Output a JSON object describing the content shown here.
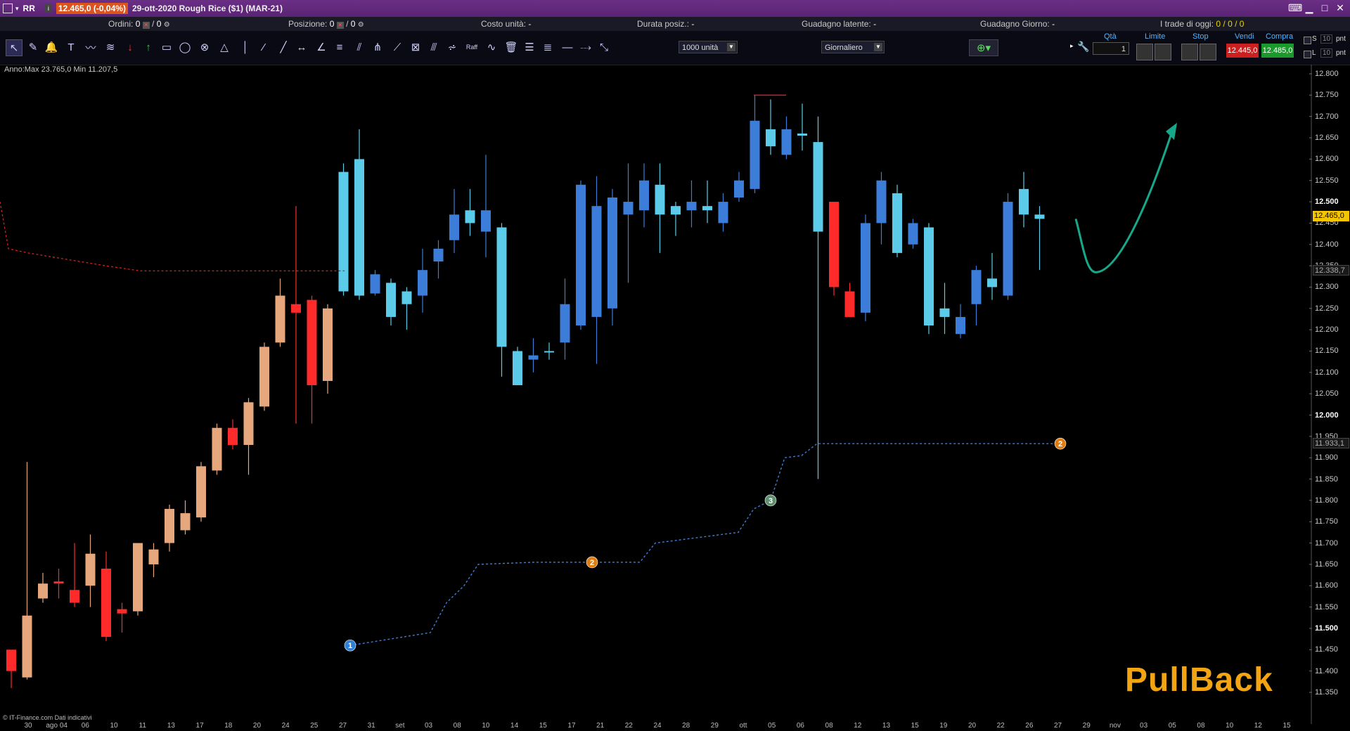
{
  "title_bar": {
    "symbol": "RR",
    "price_change": "12.465,0 (-0,04%)",
    "instrument": "29-ott-2020 Rough Rice ($1) (MAR-21)"
  },
  "info_bar": {
    "ordini_label": "Ordini:",
    "ordini_value": "0",
    "ordini_value2": "0",
    "posizione_label": "Posizione:",
    "posizione_value": "0",
    "posizione_value2": "0",
    "costo_label": "Costo unità:",
    "costo_value": "-",
    "durata_label": "Durata posiz.:",
    "durata_value": "-",
    "guadagno_latente_label": "Guadagno latente:",
    "guadagno_latente_value": "-",
    "guadagno_giorno_label": "Guadagno Giorno:",
    "guadagno_giorno_value": "-",
    "trade_oggi_label": "I trade di oggi:",
    "trade_oggi_value": "0 / 0 / 0"
  },
  "toolbar": {
    "quantity_select": "1000 unità",
    "period_select": "Giornaliero",
    "raff_label": "Raff"
  },
  "order_panel": {
    "qty_label": "Qtà",
    "qty_value": "1",
    "limit_label": "Limite",
    "stop_label": "Stop",
    "sell_label": "Vendi",
    "buy_label": "Compra",
    "sell_price": "12.445,0",
    "buy_price": "12.485,0",
    "s_label": "S",
    "l_label": "L",
    "s_value": "10",
    "l_value": "10",
    "pnt_label": "pnt"
  },
  "annotation": "Anno:Max 23.765,0 Min 11.207,5",
  "footer": "© IT-Finance.com Dati indicativi",
  "watermark": "PullBack",
  "colors": {
    "bull_orange": "#e7a77c",
    "bear_red": "#ff2a2a",
    "bull_cyan": "#5ccbe9",
    "bear_blue": "#3b7dd8",
    "accent_teal": "#17a88a",
    "dotted_red": "#d52020",
    "dotted_blue": "#3b7dd8"
  },
  "price_axis": {
    "ticks": [
      "12.800",
      "12.750",
      "12.700",
      "12.650",
      "12.600",
      "12.550",
      "12.500",
      "12.450",
      "12.400",
      "12.350",
      "12.300",
      "12.250",
      "12.200",
      "12.150",
      "12.100",
      "12.050",
      "12.000",
      "11.950",
      "11.900",
      "11.850",
      "11.800",
      "11.750",
      "11.700",
      "11.650",
      "11.600",
      "11.550",
      "11.500",
      "11.450",
      "11.400",
      "11.350"
    ],
    "bold_ticks": [
      "12.500",
      "12.000",
      "11.500"
    ],
    "current_price": "12.465,0",
    "red_line_price": "12.338,7",
    "blue_line_price": "11.933,1"
  },
  "date_axis": {
    "labels": [
      "30",
      "ago 04",
      "06",
      "10",
      "11",
      "13",
      "17",
      "18",
      "20",
      "24",
      "25",
      "27",
      "31",
      "set",
      "03",
      "08",
      "10",
      "14",
      "15",
      "17",
      "21",
      "22",
      "24",
      "28",
      "29",
      "ott",
      "05",
      "06",
      "08",
      "12",
      "13",
      "15",
      "19",
      "20",
      "22",
      "26",
      "27",
      "29",
      "nov",
      "03",
      "05",
      "08",
      "10",
      "12",
      "15"
    ]
  },
  "markers": [
    {
      "label": "1",
      "color": "#2e7fd6"
    },
    {
      "label": "2",
      "color": "#e07d12"
    },
    {
      "label": "3",
      "color": "#5f8f6f"
    },
    {
      "label": "2",
      "color": "#e07d12"
    }
  ],
  "chart_data": {
    "type": "candlestick",
    "ylim": [
      11.32,
      12.83
    ],
    "series": [
      {
        "name": "orange_bull",
        "color": "#e7a77c"
      },
      {
        "name": "red_bear",
        "color": "#ff2a2a"
      },
      {
        "name": "cyan_bull",
        "color": "#5ccbe9"
      },
      {
        "name": "blue_bear",
        "color": "#3b7dd8"
      }
    ],
    "candles": [
      {
        "o": 11.4,
        "h": 11.43,
        "l": 11.36,
        "c": 11.45,
        "k": "r"
      },
      {
        "o": 11.385,
        "h": 11.89,
        "l": 11.38,
        "c": 11.53,
        "k": "o"
      },
      {
        "o": 11.57,
        "h": 11.63,
        "l": 11.56,
        "c": 11.605,
        "k": "o"
      },
      {
        "o": 11.605,
        "h": 11.64,
        "l": 11.57,
        "c": 11.61,
        "k": "r"
      },
      {
        "o": 11.59,
        "h": 11.7,
        "l": 11.55,
        "c": 11.56,
        "k": "r"
      },
      {
        "o": 11.6,
        "h": 11.72,
        "l": 11.55,
        "c": 11.675,
        "k": "o"
      },
      {
        "o": 11.64,
        "h": 11.68,
        "l": 11.47,
        "c": 11.48,
        "k": "r"
      },
      {
        "o": 11.545,
        "h": 11.56,
        "l": 11.49,
        "c": 11.535,
        "k": "r"
      },
      {
        "o": 11.54,
        "h": 11.66,
        "l": 11.53,
        "c": 11.7,
        "k": "o"
      },
      {
        "o": 11.65,
        "h": 11.7,
        "l": 11.62,
        "c": 11.685,
        "k": "o"
      },
      {
        "o": 11.7,
        "h": 11.79,
        "l": 11.68,
        "c": 11.78,
        "k": "o"
      },
      {
        "o": 11.73,
        "h": 11.8,
        "l": 11.72,
        "c": 11.77,
        "k": "o"
      },
      {
        "o": 11.76,
        "h": 11.89,
        "l": 11.75,
        "c": 11.88,
        "k": "o"
      },
      {
        "o": 11.87,
        "h": 11.98,
        "l": 11.86,
        "c": 11.97,
        "k": "o"
      },
      {
        "o": 11.97,
        "h": 11.99,
        "l": 11.92,
        "c": 11.93,
        "k": "r"
      },
      {
        "o": 11.93,
        "h": 12.04,
        "l": 11.86,
        "c": 12.03,
        "k": "o"
      },
      {
        "o": 12.02,
        "h": 12.17,
        "l": 12.01,
        "c": 12.16,
        "k": "o"
      },
      {
        "o": 12.17,
        "h": 12.32,
        "l": 12.16,
        "c": 12.28,
        "k": "o"
      },
      {
        "o": 12.26,
        "h": 12.49,
        "l": 11.98,
        "c": 12.24,
        "k": "r"
      },
      {
        "o": 12.27,
        "h": 12.28,
        "l": 11.98,
        "c": 12.07,
        "k": "r"
      },
      {
        "o": 12.08,
        "h": 12.26,
        "l": 12.05,
        "c": 12.25,
        "k": "o"
      },
      {
        "o": 12.29,
        "h": 12.59,
        "l": 12.28,
        "c": 12.57,
        "k": "c"
      },
      {
        "o": 12.28,
        "h": 12.67,
        "l": 12.27,
        "c": 12.6,
        "k": "c"
      },
      {
        "o": 12.33,
        "h": 12.34,
        "l": 12.28,
        "c": 12.285,
        "k": "b"
      },
      {
        "o": 12.31,
        "h": 12.32,
        "l": 12.21,
        "c": 12.23,
        "k": "c"
      },
      {
        "o": 12.29,
        "h": 12.3,
        "l": 12.2,
        "c": 12.26,
        "k": "c"
      },
      {
        "o": 12.28,
        "h": 12.39,
        "l": 12.24,
        "c": 12.34,
        "k": "b"
      },
      {
        "o": 12.36,
        "h": 12.41,
        "l": 12.32,
        "c": 12.39,
        "k": "b"
      },
      {
        "o": 12.41,
        "h": 12.53,
        "l": 12.38,
        "c": 12.47,
        "k": "b"
      },
      {
        "o": 12.45,
        "h": 12.53,
        "l": 12.42,
        "c": 12.48,
        "k": "c"
      },
      {
        "o": 12.48,
        "h": 12.61,
        "l": 12.37,
        "c": 12.43,
        "k": "b"
      },
      {
        "o": 12.44,
        "h": 12.45,
        "l": 12.09,
        "c": 12.16,
        "k": "c"
      },
      {
        "o": 12.15,
        "h": 12.16,
        "l": 12.07,
        "c": 12.07,
        "k": "c"
      },
      {
        "o": 12.13,
        "h": 12.18,
        "l": 12.1,
        "c": 12.14,
        "k": "b"
      },
      {
        "o": 12.15,
        "h": 12.17,
        "l": 12.13,
        "c": 12.15,
        "k": "c"
      },
      {
        "o": 12.17,
        "h": 12.32,
        "l": 12.13,
        "c": 12.26,
        "k": "b"
      },
      {
        "o": 12.21,
        "h": 12.55,
        "l": 12.2,
        "c": 12.54,
        "k": "b"
      },
      {
        "o": 12.49,
        "h": 12.56,
        "l": 12.12,
        "c": 12.23,
        "k": "b"
      },
      {
        "o": 12.25,
        "h": 12.53,
        "l": 12.21,
        "c": 12.51,
        "k": "b"
      },
      {
        "o": 12.47,
        "h": 12.59,
        "l": 12.31,
        "c": 12.5,
        "k": "b"
      },
      {
        "o": 12.48,
        "h": 12.59,
        "l": 12.44,
        "c": 12.55,
        "k": "b"
      },
      {
        "o": 12.47,
        "h": 12.59,
        "l": 12.38,
        "c": 12.54,
        "k": "c"
      },
      {
        "o": 12.49,
        "h": 12.5,
        "l": 12.42,
        "c": 12.47,
        "k": "c"
      },
      {
        "o": 12.48,
        "h": 12.55,
        "l": 12.44,
        "c": 12.5,
        "k": "b"
      },
      {
        "o": 12.49,
        "h": 12.55,
        "l": 12.45,
        "c": 12.48,
        "k": "c"
      },
      {
        "o": 12.45,
        "h": 12.52,
        "l": 12.43,
        "c": 12.5,
        "k": "b"
      },
      {
        "o": 12.51,
        "h": 12.57,
        "l": 12.5,
        "c": 12.55,
        "k": "b"
      },
      {
        "o": 12.53,
        "h": 12.75,
        "l": 12.52,
        "c": 12.69,
        "k": "b"
      },
      {
        "o": 12.67,
        "h": 12.74,
        "l": 12.61,
        "c": 12.63,
        "k": "c"
      },
      {
        "o": 12.67,
        "h": 12.7,
        "l": 12.6,
        "c": 12.61,
        "k": "b"
      },
      {
        "o": 12.66,
        "h": 12.73,
        "l": 12.62,
        "c": 12.655,
        "k": "c"
      },
      {
        "o": 12.64,
        "h": 12.7,
        "l": 11.85,
        "c": 12.43,
        "k": "c"
      },
      {
        "o": 12.5,
        "h": 12.49,
        "l": 12.28,
        "c": 12.3,
        "k": "r"
      },
      {
        "o": 12.29,
        "h": 12.31,
        "l": 12.23,
        "c": 12.23,
        "k": "r"
      },
      {
        "o": 12.24,
        "h": 12.47,
        "l": 12.22,
        "c": 12.45,
        "k": "b"
      },
      {
        "o": 12.45,
        "h": 12.57,
        "l": 12.4,
        "c": 12.55,
        "k": "b"
      },
      {
        "o": 12.52,
        "h": 12.54,
        "l": 12.37,
        "c": 12.38,
        "k": "c"
      },
      {
        "o": 12.45,
        "h": 12.46,
        "l": 12.39,
        "c": 12.4,
        "k": "b"
      },
      {
        "o": 12.44,
        "h": 12.45,
        "l": 12.19,
        "c": 12.21,
        "k": "c"
      },
      {
        "o": 12.25,
        "h": 12.31,
        "l": 12.19,
        "c": 12.23,
        "k": "c"
      },
      {
        "o": 12.19,
        "h": 12.26,
        "l": 12.18,
        "c": 12.23,
        "k": "b"
      },
      {
        "o": 12.26,
        "h": 12.35,
        "l": 12.21,
        "c": 12.34,
        "k": "b"
      },
      {
        "o": 12.3,
        "h": 12.38,
        "l": 12.27,
        "c": 12.32,
        "k": "c"
      },
      {
        "o": 12.28,
        "h": 12.52,
        "l": 12.27,
        "c": 12.5,
        "k": "b"
      },
      {
        "o": 12.53,
        "h": 12.57,
        "l": 12.44,
        "c": 12.47,
        "k": "c"
      },
      {
        "o": 12.46,
        "h": 12.49,
        "l": 12.34,
        "c": 12.47,
        "k": "c"
      }
    ]
  }
}
